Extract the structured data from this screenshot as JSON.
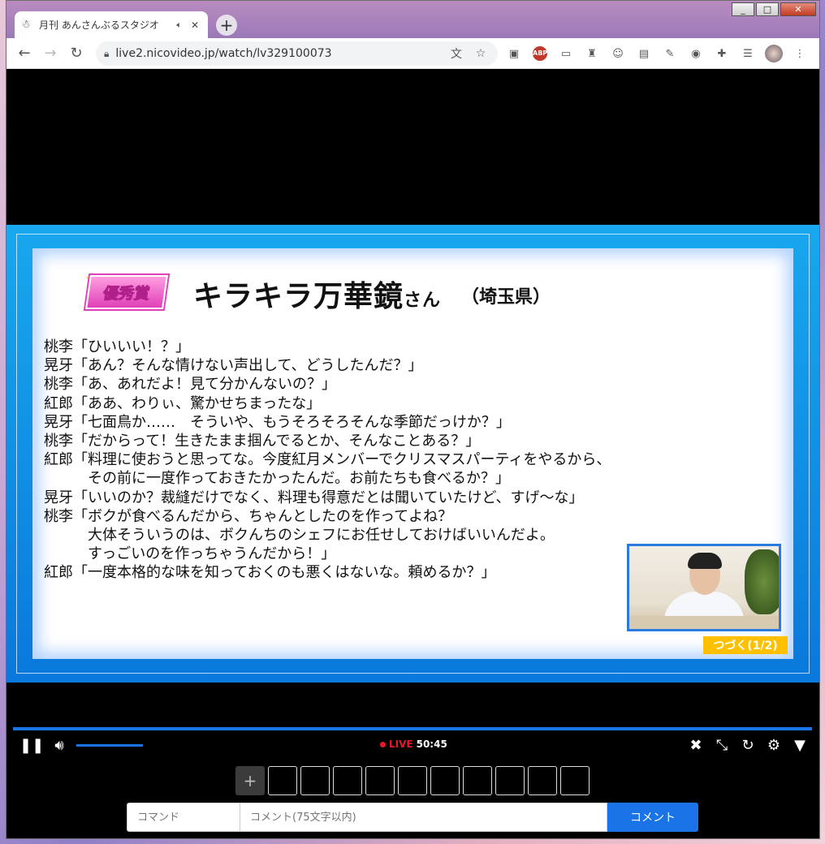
{
  "browser": {
    "tab_title": "月刊 あんさんぶるスタジオ",
    "tab_audio_icon": "speaker-icon",
    "tab_close": "✕",
    "new_tab": "+",
    "url": "live2.nicovideo.jp/watch/lv329100073",
    "window_controls": [
      "_",
      "□",
      "✕"
    ]
  },
  "slide": {
    "award_label": "優秀賞",
    "winner_name": "キラキラ万華鏡",
    "winner_suffix": "さん",
    "winner_prefecture": "（埼玉県）",
    "lines": [
      "桃李「ひいいい！？」",
      "晃牙「あん？そんな情けない声出して、どうしたんだ？」",
      "桃李「あ、あれだよ！見て分かんないの？」",
      "紅郎「ああ、わりぃ、驚かせちまったな」",
      "晃牙「七面鳥か……　そういや、もうそろそろそんな季節だっけか？」",
      "桃李「だからって！生きたまま掴んでるとか、そんなことある？」",
      "紅郎「料理に使おうと思ってな。今度紅月メンバーでクリスマスパーティをやるから、",
      "　　　その前に一度作っておきたかったんだ。お前たちも食べるか？」",
      "晃牙「いいのか？裁縫だけでなく、料理も得意だとは聞いていたけど、すげ～な」",
      "桃李「ボクが食べるんだから、ちゃんとしたのを作ってよね？",
      "　　　大体そういうのは、ボクんちのシェフにお任せしておけばいいんだよ。",
      "　　　すっごいのを作っちゃうんだから！」",
      "紅郎「一度本格的な味を知っておくのも悪くはないな。頼めるか？」"
    ],
    "continue_badge": "つづく(1/2)"
  },
  "player": {
    "live_label": "LIVE",
    "elapsed": "50:45",
    "volume_level": 0.85
  },
  "comment": {
    "command_placeholder": "コマンド",
    "comment_placeholder": "コメント(75文字以内)",
    "submit_label": "コメント"
  },
  "gift": {
    "add_label": "+",
    "slot_count": 10
  }
}
